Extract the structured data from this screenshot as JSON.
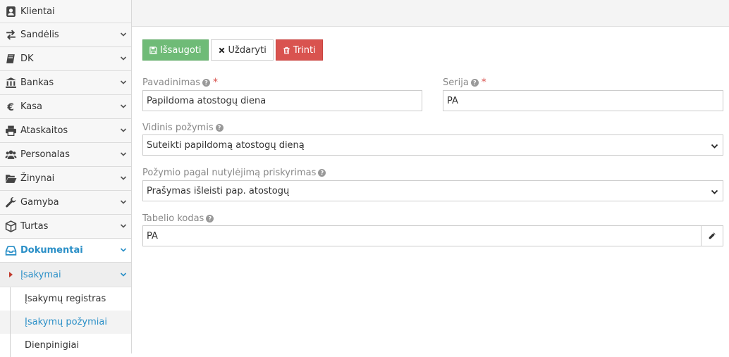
{
  "sidebar": {
    "items": [
      {
        "label": "Klientai",
        "icon": "contact-icon"
      },
      {
        "label": "Sandėlis",
        "icon": "exchange-icon"
      },
      {
        "label": "DK",
        "icon": "book-icon"
      },
      {
        "label": "Bankas",
        "icon": "bank-icon"
      },
      {
        "label": "Kasa",
        "icon": "euro-icon"
      },
      {
        "label": "Ataskaitos",
        "icon": "print-icon"
      },
      {
        "label": "Personalas",
        "icon": "users-icon"
      },
      {
        "label": "Žinynai",
        "icon": "folder-open-icon"
      },
      {
        "label": "Gamyba",
        "icon": "wrench-icon"
      },
      {
        "label": "Turtas",
        "icon": "cube-icon"
      },
      {
        "label": "Dokumentai",
        "icon": "inbox-icon"
      }
    ],
    "submenu": {
      "label": "Įsakymai",
      "items": [
        "Įsakymų registras",
        "Įsakymų požymiai",
        "Dienpinigiai"
      ]
    }
  },
  "toolbar": {
    "save_label": "Išsaugoti",
    "close_label": "Uždaryti",
    "delete_label": "Trinti"
  },
  "form": {
    "name": {
      "label": "Pavadinimas",
      "value": "Papildoma atostogų diena"
    },
    "series": {
      "label": "Serija",
      "value": "PA"
    },
    "internal": {
      "label": "Vidinis požymis",
      "value": "Suteikti papildomą atostogų dieną"
    },
    "default_assign": {
      "label": "Požymio pagal nutylėjimą priskyrimas",
      "value": "Prašymas išleisti pap. atostogų"
    },
    "tabel_code": {
      "label": "Tabelio kodas",
      "value": "PA"
    }
  },
  "colors": {
    "accent": "#2a8fc7",
    "save": "#6fbb77",
    "delete": "#d9534f",
    "required": "#d9534f"
  }
}
